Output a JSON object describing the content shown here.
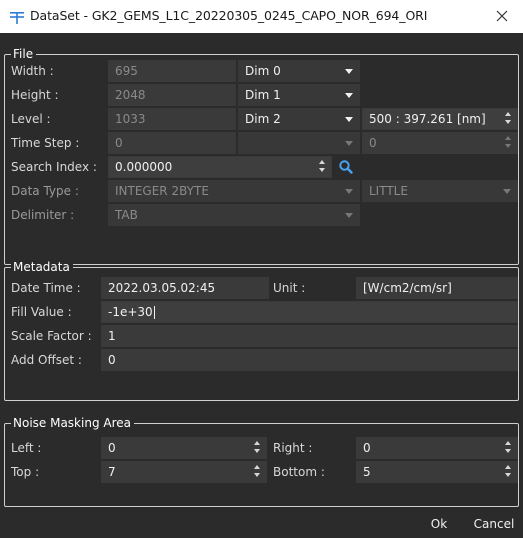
{
  "window": {
    "title": "DataSet - GK2_GEMS_L1C_20220305_0245_CAPO_NOR_694_ORI",
    "app_icon": "dataset-icon",
    "close_icon": "close-icon",
    "close_glyph": "✕"
  },
  "file": {
    "title": "File",
    "width": {
      "label": "Width :",
      "value": "695",
      "dim": "Dim 0"
    },
    "height": {
      "label": "Height :",
      "value": "2048",
      "dim": "Dim 1"
    },
    "level": {
      "label": "Level :",
      "value": "1033",
      "dim": "Dim 2",
      "level_select": "500 : 397.261 [nm]"
    },
    "time_step": {
      "label": "Time Step :",
      "value": "0",
      "dim": "",
      "spin_value": "0"
    },
    "search_index": {
      "label": "Search Index :",
      "value": "0.000000",
      "icon": "search-icon"
    },
    "data_type": {
      "label": "Data Type :",
      "value": "INTEGER 2BYTE",
      "endian": "LITTLE"
    },
    "delimiter": {
      "label": "Delimiter :",
      "value": "TAB"
    }
  },
  "metadata": {
    "title": "Metadata",
    "date_time": {
      "label": "Date Time :",
      "value": "2022.03.05.02:45"
    },
    "unit": {
      "label": "Unit :",
      "value": "[W/cm2/cm/sr]"
    },
    "fill_value": {
      "label": "Fill Value :",
      "value": "-1e+30"
    },
    "scale_factor": {
      "label": "Scale Factor :",
      "value": "1"
    },
    "add_offset": {
      "label": "Add Offset :",
      "value": "0"
    }
  },
  "noise": {
    "title": "Noise Masking Area",
    "left": {
      "label": "Left :",
      "value": "0"
    },
    "right": {
      "label": "Right :",
      "value": "0"
    },
    "top": {
      "label": "Top :",
      "value": "7"
    },
    "bottom": {
      "label": "Bottom :",
      "value": "5"
    }
  },
  "buttons": {
    "ok": "Ok",
    "cancel": "Cancel"
  },
  "colors": {
    "background": "#2b2b2b",
    "field": "#3a3a3a",
    "accent_search": "#4aa3f0",
    "title_icon": "#2e7bd6"
  }
}
